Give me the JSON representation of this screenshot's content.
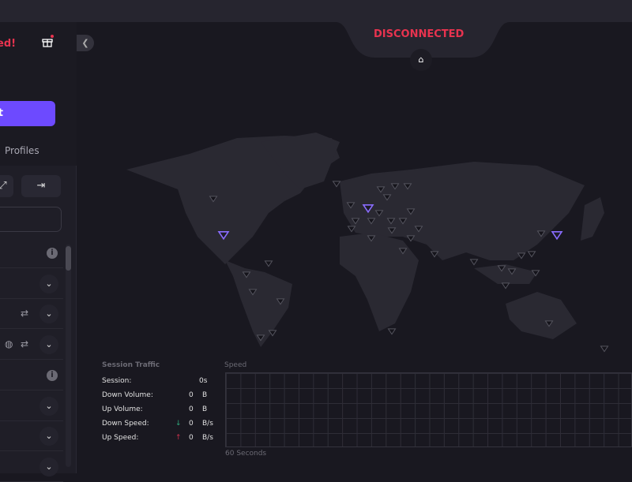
{
  "sidebar": {
    "status": "ed!",
    "connect_label": "t",
    "tab_profiles": "Profiles",
    "btn_left": "⤢",
    "btn_right": "⇥",
    "rows": [
      {
        "type": "header"
      },
      {
        "type": "item"
      },
      {
        "type": "item",
        "icons": [
          "⇄"
        ]
      },
      {
        "type": "item",
        "icons": [
          "◍",
          "⇄"
        ]
      },
      {
        "type": "header"
      },
      {
        "type": "item"
      },
      {
        "type": "item"
      },
      {
        "type": "item"
      }
    ]
  },
  "header": {
    "status": "DISCONNECTED"
  },
  "traffic": {
    "title": "Session Traffic",
    "rows": [
      {
        "label": "Session:",
        "value": "0s",
        "unit": ""
      },
      {
        "label": "Down Volume:",
        "value": "0",
        "unit": "B"
      },
      {
        "label": "Up Volume:",
        "value": "0",
        "unit": "B"
      },
      {
        "label": "Down Speed:",
        "arrow": "↓",
        "value": "0",
        "unit": "B/s"
      },
      {
        "label": "Up Speed:",
        "arrow": "↑",
        "value": "0",
        "unit": "B/s"
      }
    ]
  },
  "speed": {
    "title": "Speed",
    "axis": "60 Seconds"
  },
  "colors": {
    "accent": "#6d4aff",
    "danger": "#e8334f",
    "down": "#2ea77a",
    "up": "#c9304c"
  }
}
